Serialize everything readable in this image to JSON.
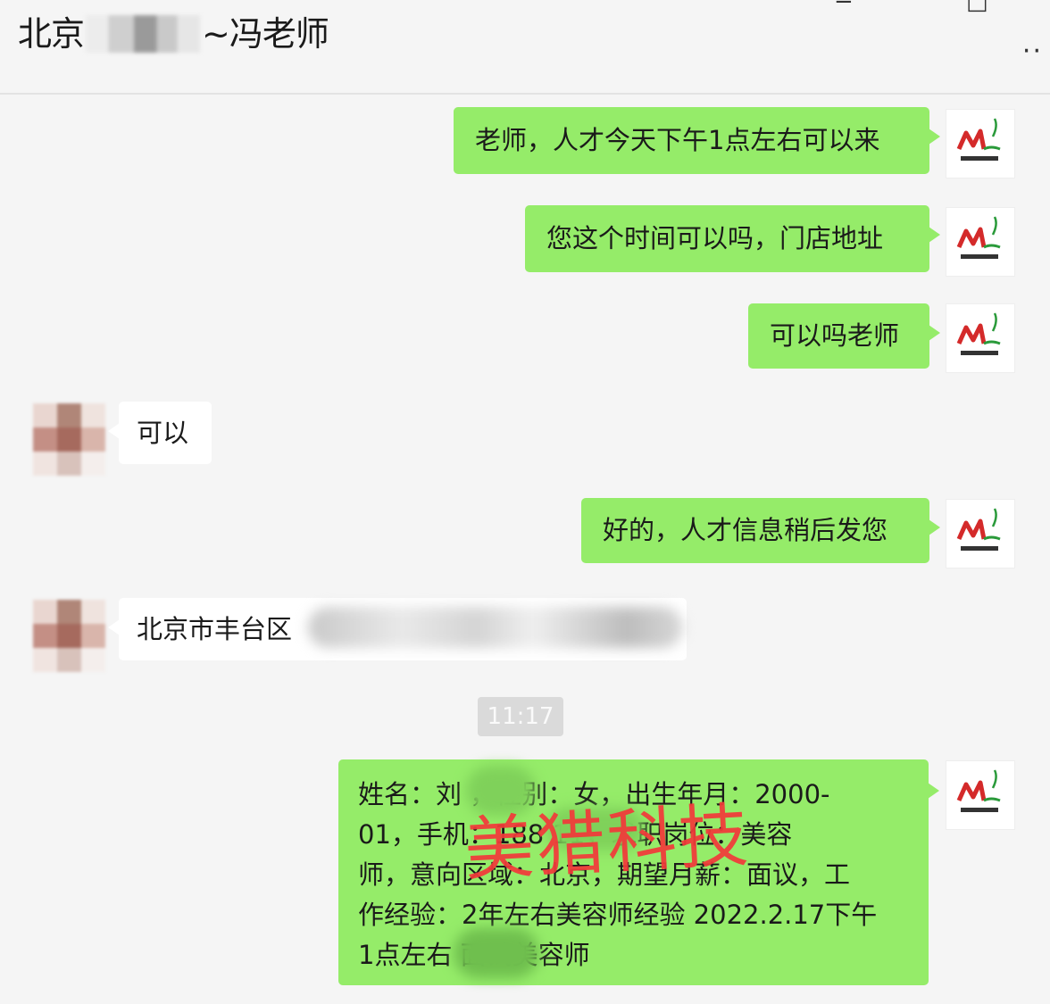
{
  "window": {
    "title_prefix": "北京",
    "title_suffix": "~冯老师",
    "minimize_glyph": "−",
    "maximize_glyph": "□",
    "more_glyph": "··"
  },
  "colors": {
    "outgoing": "#95ec69",
    "incoming": "#ffffff",
    "background": "#f5f5f5",
    "watermark": "#f23a3a"
  },
  "messages": [
    {
      "side": "out",
      "text": "老师，人才今天下午1点左右可以来"
    },
    {
      "side": "out",
      "text": "您这个时间可以吗，门店地址"
    },
    {
      "side": "out",
      "text": "可以吗老师"
    },
    {
      "side": "in",
      "text": "可以"
    },
    {
      "side": "out",
      "text": "好的，人才信息稍后发您"
    },
    {
      "side": "in",
      "text": "北京市丰台区"
    }
  ],
  "timestamp": "11:17",
  "profile_message": {
    "lines": [
      "姓名：刘        ，性别：女，出生年月：2000-",
      "01，手机：188             11，求职岗位：美容",
      "师，意向区域：北京，期望月薪：面议，工",
      "作经验：2年左右美容师经验 2022.2.17下午",
      "1点左右              面试美容师"
    ]
  },
  "watermark": "美猎科技",
  "avatar_icon": "meilie-tech-logo-icon"
}
